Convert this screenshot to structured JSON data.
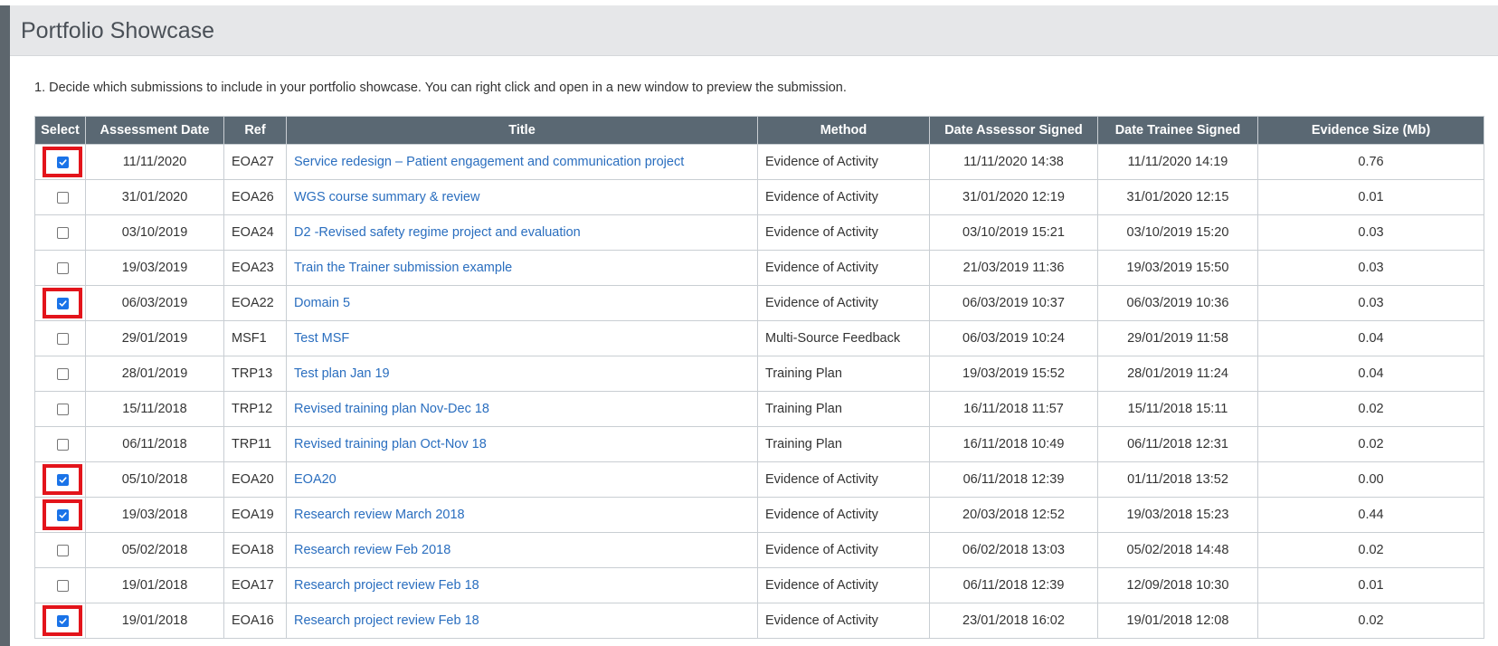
{
  "panel": {
    "title": "Portfolio Showcase",
    "instruction": "1. Decide which submissions to include in your portfolio showcase. You can right click and open in a new window to preview the submission."
  },
  "table": {
    "headers": [
      "Select",
      "Assessment Date",
      "Ref",
      "Title",
      "Method",
      "Date Assessor Signed",
      "Date Trainee Signed",
      "Evidence Size (Mb)"
    ],
    "rows": [
      {
        "checked": true,
        "highlighted": true,
        "assessment_date": "11/11/2020",
        "ref": "EOA27",
        "title": "Service redesign – Patient engagement and communication project",
        "method": "Evidence of Activity",
        "assessor_signed": "11/11/2020 14:38",
        "trainee_signed": "11/11/2020 14:19",
        "size": "0.76"
      },
      {
        "checked": false,
        "highlighted": false,
        "assessment_date": "31/01/2020",
        "ref": "EOA26",
        "title": "WGS course summary & review",
        "method": "Evidence of Activity",
        "assessor_signed": "31/01/2020 12:19",
        "trainee_signed": "31/01/2020 12:15",
        "size": "0.01"
      },
      {
        "checked": false,
        "highlighted": false,
        "assessment_date": "03/10/2019",
        "ref": "EOA24",
        "title": "D2 -Revised safety regime project and evaluation",
        "method": "Evidence of Activity",
        "assessor_signed": "03/10/2019 15:21",
        "trainee_signed": "03/10/2019 15:20",
        "size": "0.03"
      },
      {
        "checked": false,
        "highlighted": false,
        "assessment_date": "19/03/2019",
        "ref": "EOA23",
        "title": "Train the Trainer submission example",
        "method": "Evidence of Activity",
        "assessor_signed": "21/03/2019 11:36",
        "trainee_signed": "19/03/2019 15:50",
        "size": "0.03"
      },
      {
        "checked": true,
        "highlighted": true,
        "assessment_date": "06/03/2019",
        "ref": "EOA22",
        "title": "Domain 5",
        "method": "Evidence of Activity",
        "assessor_signed": "06/03/2019 10:37",
        "trainee_signed": "06/03/2019 10:36",
        "size": "0.03"
      },
      {
        "checked": false,
        "highlighted": false,
        "assessment_date": "29/01/2019",
        "ref": "MSF1",
        "title": "Test MSF",
        "method": "Multi-Source Feedback",
        "assessor_signed": "06/03/2019 10:24",
        "trainee_signed": "29/01/2019 11:58",
        "size": "0.04"
      },
      {
        "checked": false,
        "highlighted": false,
        "assessment_date": "28/01/2019",
        "ref": "TRP13",
        "title": "Test plan Jan 19",
        "method": "Training Plan",
        "assessor_signed": "19/03/2019 15:52",
        "trainee_signed": "28/01/2019 11:24",
        "size": "0.04"
      },
      {
        "checked": false,
        "highlighted": false,
        "assessment_date": "15/11/2018",
        "ref": "TRP12",
        "title": "Revised training plan Nov-Dec 18",
        "method": "Training Plan",
        "assessor_signed": "16/11/2018 11:57",
        "trainee_signed": "15/11/2018 15:11",
        "size": "0.02"
      },
      {
        "checked": false,
        "highlighted": false,
        "assessment_date": "06/11/2018",
        "ref": "TRP11",
        "title": "Revised training plan Oct-Nov 18",
        "method": "Training Plan",
        "assessor_signed": "16/11/2018 10:49",
        "trainee_signed": "06/11/2018 12:31",
        "size": "0.02"
      },
      {
        "checked": true,
        "highlighted": true,
        "assessment_date": "05/10/2018",
        "ref": "EOA20",
        "title": "EOA20",
        "method": "Evidence of Activity",
        "assessor_signed": "06/11/2018 12:39",
        "trainee_signed": "01/11/2018 13:52",
        "size": "0.00"
      },
      {
        "checked": true,
        "highlighted": true,
        "assessment_date": "19/03/2018",
        "ref": "EOA19",
        "title": "Research review March 2018",
        "method": "Evidence of Activity",
        "assessor_signed": "20/03/2018 12:52",
        "trainee_signed": "19/03/2018 15:23",
        "size": "0.44"
      },
      {
        "checked": false,
        "highlighted": false,
        "assessment_date": "05/02/2018",
        "ref": "EOA18",
        "title": "Research review Feb 2018",
        "method": "Evidence of Activity",
        "assessor_signed": "06/02/2018 13:03",
        "trainee_signed": "05/02/2018 14:48",
        "size": "0.02"
      },
      {
        "checked": false,
        "highlighted": false,
        "assessment_date": "19/01/2018",
        "ref": "EOA17",
        "title": "Research project review Feb 18",
        "method": "Evidence of Activity",
        "assessor_signed": "06/11/2018 12:39",
        "trainee_signed": "12/09/2018 10:30",
        "size": "0.01"
      },
      {
        "checked": true,
        "highlighted": true,
        "assessment_date": "19/01/2018",
        "ref": "EOA16",
        "title": "Research project review Feb 18",
        "method": "Evidence of Activity",
        "assessor_signed": "23/01/2018 16:02",
        "trainee_signed": "19/01/2018 12:08",
        "size": "0.02"
      }
    ]
  },
  "colors": {
    "header_bg": "#5a6873",
    "link": "#2a6ebf",
    "highlight": "#e3141b",
    "checkbox_checked": "#1a73e8"
  }
}
